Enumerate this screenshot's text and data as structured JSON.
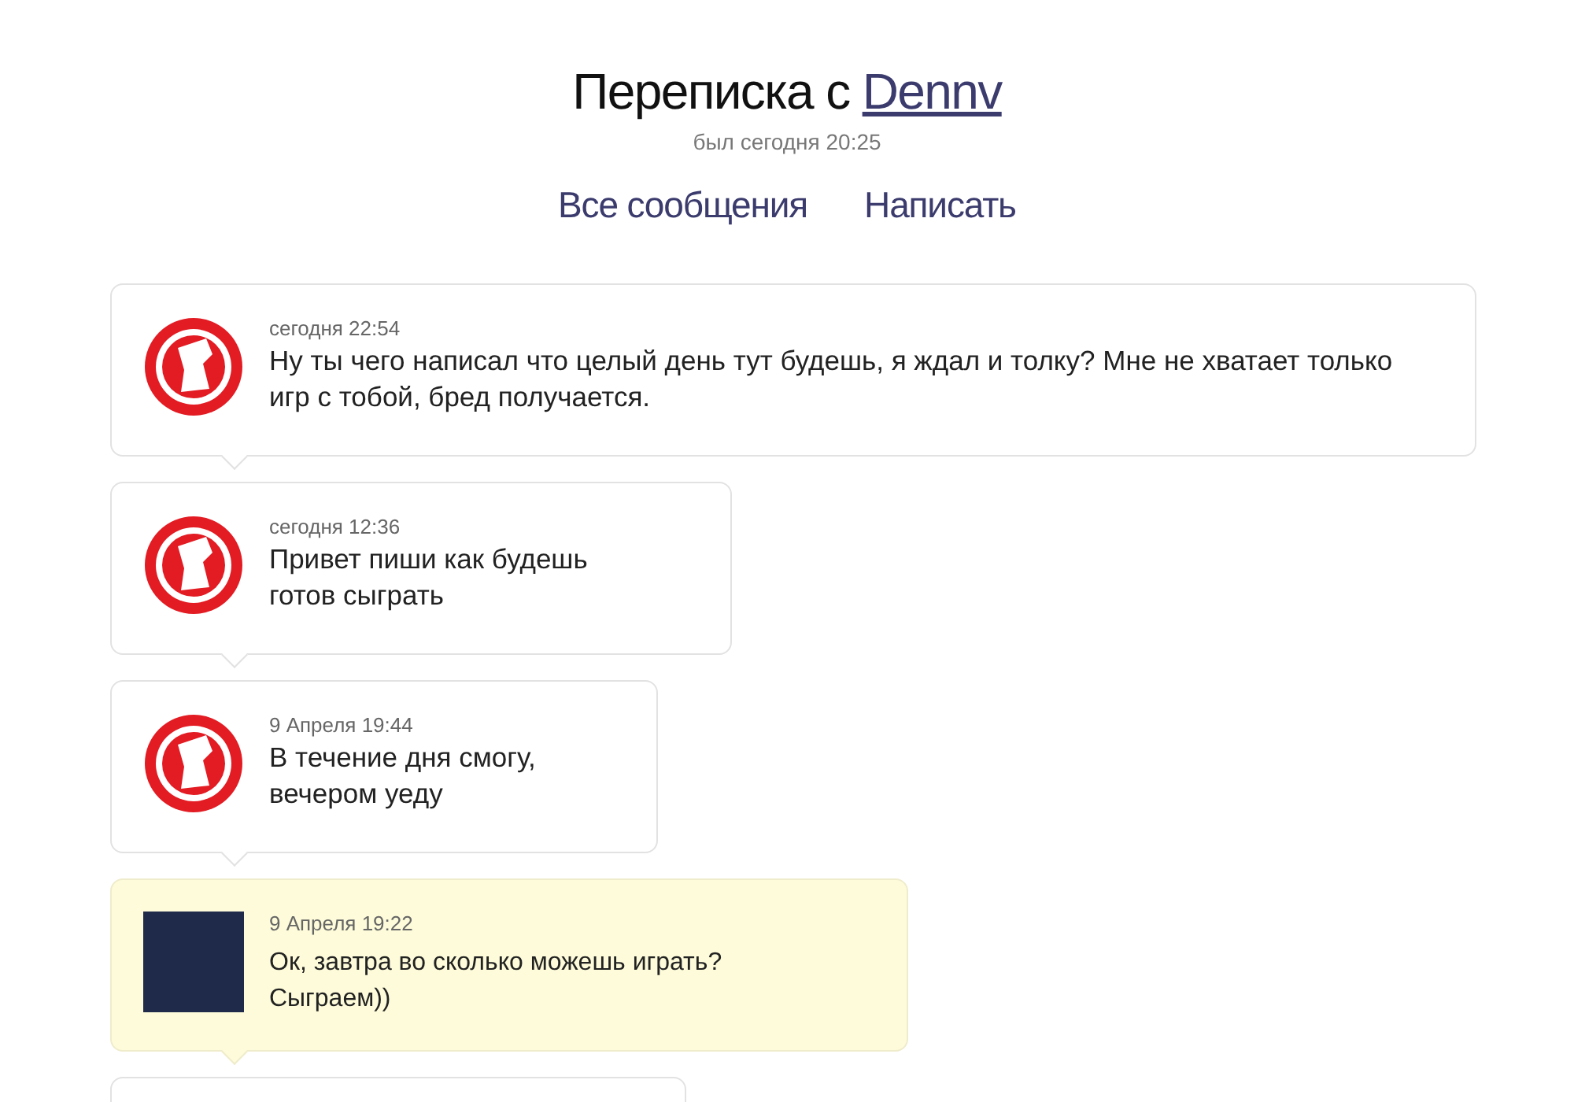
{
  "header": {
    "title_prefix": "Переписка с",
    "username": "Dennv",
    "last_seen": "был сегодня 20:25"
  },
  "nav": [
    {
      "label": "Все сообщения"
    },
    {
      "label": "Написать"
    }
  ],
  "messages": [
    {
      "kind": "incoming",
      "time": "сегодня 22:54",
      "text": "Ну ты чего написал что целый день тут будешь, я ждал и толку? Мне не хватает только игр с тобой, бред получается."
    },
    {
      "kind": "incoming",
      "time": "сегодня 12:36",
      "text": "Привет пиши как будешь готов сыграть"
    },
    {
      "kind": "incoming",
      "time": "9 Апреля 19:44",
      "text": "В течение дня смогу, вечером уеду"
    },
    {
      "kind": "outgoing",
      "time": "9 Апреля 19:22",
      "text": "Ок, завтра во сколько можешь играть? Сыграем))"
    }
  ]
}
